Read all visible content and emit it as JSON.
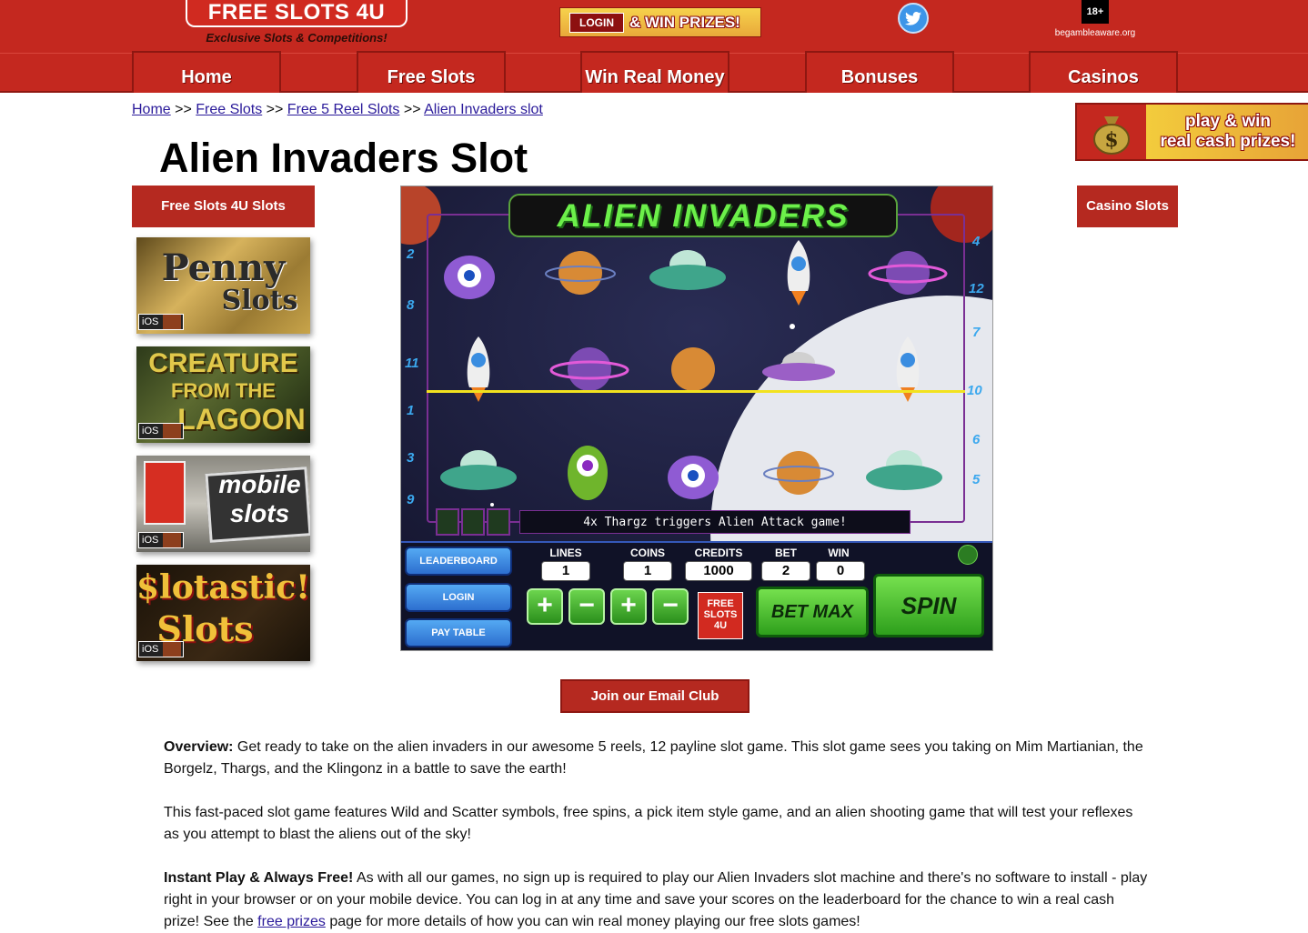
{
  "header": {
    "logo": "FREE SLOTS 4U",
    "tagline": "Exclusive Slots & Competitions!",
    "login_label": "LOGIN",
    "win_prizes": "& WIN PRIZES!",
    "age_badge": "18+",
    "gamble_aware": "begambleaware.org",
    "nav": [
      "Home",
      "Free Slots",
      "Win Real Money",
      "Bonuses",
      "Casinos"
    ]
  },
  "breadcrumb": {
    "items": [
      "Home",
      "Free Slots",
      "Free 5 Reel Slots",
      "Alien Invaders slot"
    ],
    "separator": ">>"
  },
  "page_title": "Alien Invaders Slot",
  "ad": {
    "line1": "play & win",
    "line2": "real cash prizes!"
  },
  "sidebar_left": {
    "header": "Free Slots 4U Slots",
    "thumbs": [
      {
        "title1": "Penny",
        "title2": "Slots",
        "badge": "iOS"
      },
      {
        "title1": "CREATURE",
        "title2": "FROM THE",
        "title3": "LAGOON",
        "badge": "iOS"
      },
      {
        "title1": "mobile",
        "title2": "slots",
        "badge": "iOS"
      },
      {
        "title1": "$lotastic!",
        "title2": "Slots",
        "badge": "iOS"
      }
    ]
  },
  "sidebar_right": {
    "header": "Casino Slots"
  },
  "game": {
    "title": "ALIEN INVADERS",
    "paylines_left": [
      "2",
      "8",
      "11",
      "1",
      "3",
      "9"
    ],
    "paylines_right": [
      "4",
      "12",
      "7",
      "10",
      "6",
      "5"
    ],
    "message": "4x Thargz triggers Alien Attack game!",
    "buttons": {
      "leaderboard": "LEADERBOARD",
      "login": "LOGIN",
      "paytable": "PAY TABLE"
    },
    "stats": {
      "lines_label": "LINES",
      "lines": "1",
      "coins_label": "COINS",
      "coins": "1",
      "credits_label": "CREDITS",
      "credits": "1000",
      "bet_label": "BET",
      "bet": "2",
      "win_label": "WIN",
      "win": "0"
    },
    "plus": "+",
    "minus": "−",
    "free_logo": "FREE SLOTS 4U",
    "bet_max": "BET MAX",
    "spin": "SPIN"
  },
  "email_club": "Join our Email Club",
  "content": {
    "overview_label": "Overview:",
    "overview_text": " Get ready to take on the alien invaders in our awesome 5 reels, 12 payline slot game. This slot game sees you taking on Mim Martianian, the Borgelz, Thargs, and the Klingonz in a battle to save the earth!",
    "para2": "This fast-paced slot game features Wild and Scatter symbols, free spins, a pick item style game, and an alien shooting game that will test your reflexes as you attempt to blast the aliens out of the sky!",
    "instant_label": "Instant Play & Always Free!",
    "instant_text_1": " As with all our games, no sign up is required to play our Alien Invaders slot machine and there's no software to install - play right in your browser or on your mobile device. You can log in at any time and save your scores on the leaderboard for the chance to win a real cash prize! See the ",
    "free_prizes_link": "free prizes",
    "instant_text_2": " page for more details of how you can win real money playing our free slots games!"
  },
  "colors": {
    "header_red": "#c4281f",
    "button_red": "#b52920",
    "link": "#2a1a9a"
  }
}
